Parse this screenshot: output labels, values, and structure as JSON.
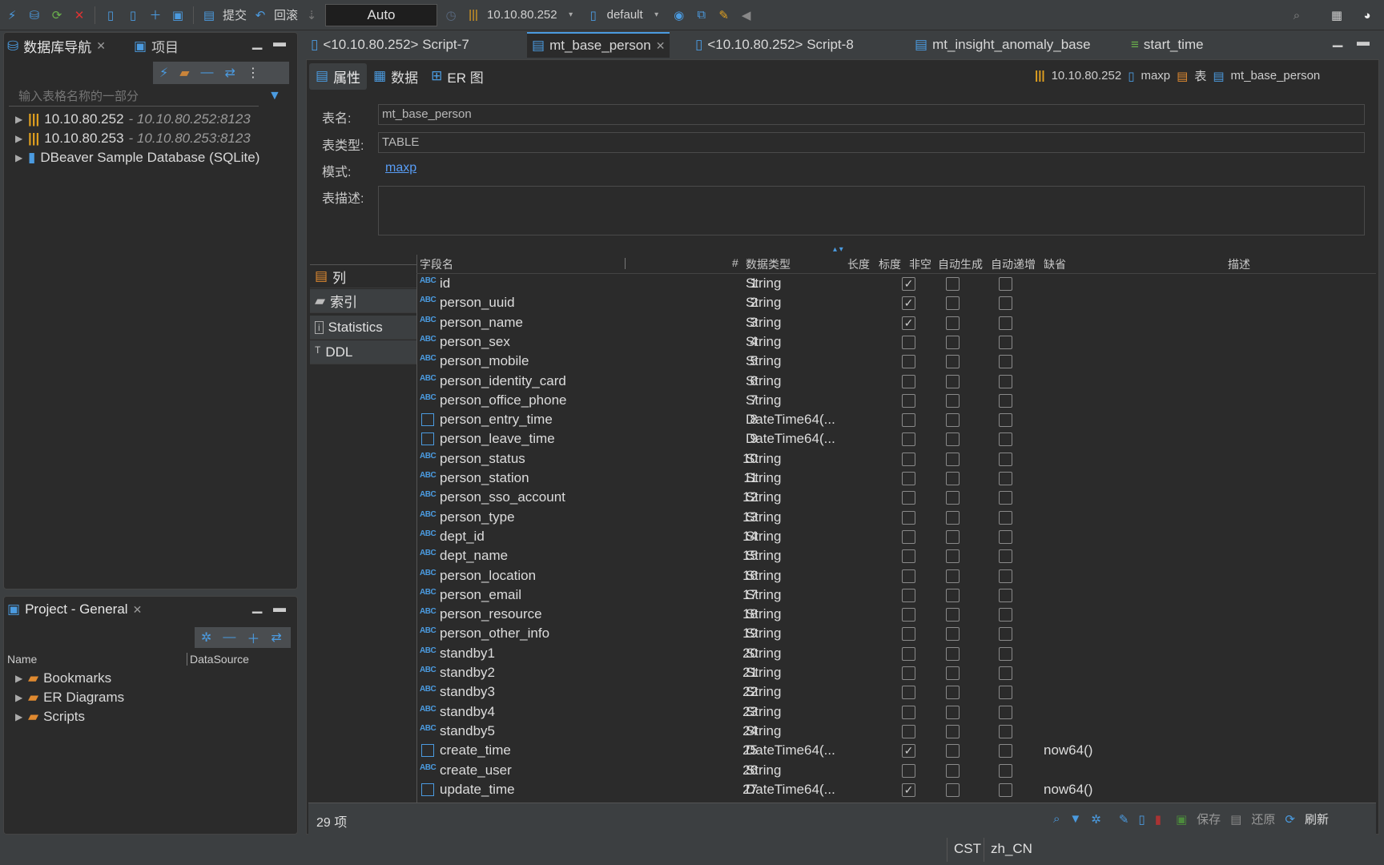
{
  "toolbar": {
    "commit_label": "提交",
    "rollback_label": "回滚",
    "mode_value": "Auto",
    "connection_label": "10.10.80.252",
    "schema_label": "default"
  },
  "nav_panel": {
    "title": "数据库导航",
    "project_tab": "项目",
    "filter_placeholder": "输入表格名称的一部分",
    "items": [
      {
        "label": "10.10.80.252",
        "sub": "- 10.10.80.252:8123"
      },
      {
        "label": "10.10.80.253",
        "sub": "- 10.10.80.253:8123"
      },
      {
        "label": "DBeaver Sample Database (SQLite)",
        "sub": ""
      }
    ]
  },
  "project_panel": {
    "title": "Project - General",
    "col_name": "Name",
    "col_datasource": "DataSource",
    "items": [
      "Bookmarks",
      "ER Diagrams",
      "Scripts"
    ]
  },
  "editor_tabs": [
    "<10.10.80.252> Script-7",
    "mt_base_person",
    "<10.10.80.252> Script-8",
    "mt_insight_anomaly_base",
    "start_time"
  ],
  "sub_tabs": {
    "properties": "属性",
    "data": "数据",
    "er": "ER 图"
  },
  "breadcrumb": {
    "conn": "10.10.80.252",
    "schema": "maxp",
    "type": "表",
    "table": "mt_base_person"
  },
  "form": {
    "name_label": "表名:",
    "name_value": "mt_base_person",
    "type_label": "表类型:",
    "type_value": "TABLE",
    "schema_label": "模式:",
    "schema_value": "maxp",
    "desc_label": "表描述:"
  },
  "side_tabs": {
    "columns": "列",
    "indexes": "索引",
    "stats": "Statistics",
    "ddl": "DDL"
  },
  "grid": {
    "headers": {
      "name": "字段名",
      "num": "#",
      "type": "数据类型",
      "len": "长度",
      "scale": "标度",
      "notnull": "非空",
      "autogen": "自动生成",
      "autoinc": "自动递增",
      "default": "缺省",
      "desc": "描述"
    },
    "rows": [
      {
        "n": "id",
        "i": "1",
        "t": "String",
        "nn": true,
        "d": ""
      },
      {
        "n": "person_uuid",
        "i": "2",
        "t": "String",
        "nn": true,
        "d": ""
      },
      {
        "n": "person_name",
        "i": "3",
        "t": "String",
        "nn": true,
        "d": ""
      },
      {
        "n": "person_sex",
        "i": "4",
        "t": "String",
        "nn": false,
        "d": ""
      },
      {
        "n": "person_mobile",
        "i": "5",
        "t": "String",
        "nn": false,
        "d": ""
      },
      {
        "n": "person_identity_card",
        "i": "6",
        "t": "String",
        "nn": false,
        "d": ""
      },
      {
        "n": "person_office_phone",
        "i": "7",
        "t": "String",
        "nn": false,
        "d": ""
      },
      {
        "n": "person_entry_time",
        "i": "8",
        "t": "DateTime64(...",
        "nn": false,
        "d": "",
        "dt": true
      },
      {
        "n": "person_leave_time",
        "i": "9",
        "t": "DateTime64(...",
        "nn": false,
        "d": "",
        "dt": true
      },
      {
        "n": "person_status",
        "i": "10",
        "t": "String",
        "nn": false,
        "d": ""
      },
      {
        "n": "person_station",
        "i": "11",
        "t": "String",
        "nn": false,
        "d": ""
      },
      {
        "n": "person_sso_account",
        "i": "12",
        "t": "String",
        "nn": false,
        "d": ""
      },
      {
        "n": "person_type",
        "i": "13",
        "t": "String",
        "nn": false,
        "d": ""
      },
      {
        "n": "dept_id",
        "i": "14",
        "t": "String",
        "nn": false,
        "d": ""
      },
      {
        "n": "dept_name",
        "i": "15",
        "t": "String",
        "nn": false,
        "d": ""
      },
      {
        "n": "person_location",
        "i": "16",
        "t": "String",
        "nn": false,
        "d": ""
      },
      {
        "n": "person_email",
        "i": "17",
        "t": "String",
        "nn": false,
        "d": ""
      },
      {
        "n": "person_resource",
        "i": "18",
        "t": "String",
        "nn": false,
        "d": ""
      },
      {
        "n": "person_other_info",
        "i": "19",
        "t": "String",
        "nn": false,
        "d": ""
      },
      {
        "n": "standby1",
        "i": "20",
        "t": "String",
        "nn": false,
        "d": ""
      },
      {
        "n": "standby2",
        "i": "21",
        "t": "String",
        "nn": false,
        "d": ""
      },
      {
        "n": "standby3",
        "i": "22",
        "t": "String",
        "nn": false,
        "d": ""
      },
      {
        "n": "standby4",
        "i": "23",
        "t": "String",
        "nn": false,
        "d": ""
      },
      {
        "n": "standby5",
        "i": "24",
        "t": "String",
        "nn": false,
        "d": ""
      },
      {
        "n": "create_time",
        "i": "25",
        "t": "DateTime64(...",
        "nn": true,
        "d": "now64()",
        "dt": true
      },
      {
        "n": "create_user",
        "i": "26",
        "t": "String",
        "nn": false,
        "d": ""
      },
      {
        "n": "update_time",
        "i": "27",
        "t": "DateTime64(...",
        "nn": true,
        "d": "now64()",
        "dt": true
      }
    ]
  },
  "bottom": {
    "count": "29 项",
    "save": "保存",
    "revert": "还原",
    "refresh": "刷新"
  },
  "statusbar": {
    "tz": "CST",
    "locale": "zh_CN"
  },
  "colors": {
    "accent": "#4b9be0",
    "bg": "#2b2b2b",
    "chrome": "#3c3f41"
  }
}
